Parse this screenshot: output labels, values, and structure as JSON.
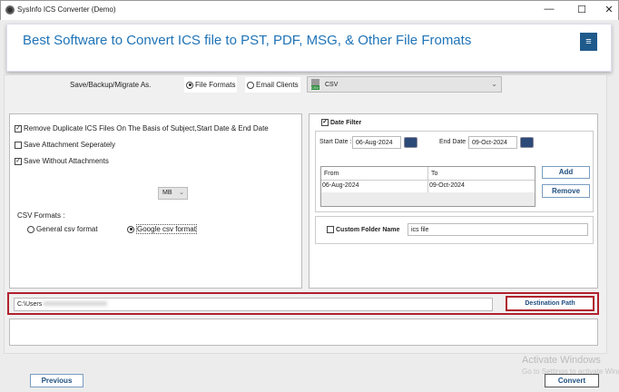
{
  "window": {
    "title": "SysInfo ICS Converter (Demo)",
    "minimize": "—",
    "maximize": "☐",
    "close": "✕"
  },
  "banner": {
    "headline": "Best Software to Convert ICS file to PST, PDF, MSG, & Other File Fromats",
    "menu_icon": "≡"
  },
  "save_as": {
    "label": "Save/Backup/Migrate As.",
    "options": [
      {
        "label": "File Formats",
        "selected": true
      },
      {
        "label": "Email Clients",
        "selected": false
      }
    ],
    "format_selected": "CSV",
    "format_icon_text": "CSV"
  },
  "options": {
    "remove_duplicates": {
      "label": "Remove Duplicate ICS Files On The Basis of Subject,Start Date & End Date",
      "checked": true
    },
    "save_attachment_separately": {
      "label": "Save Attachment Seperately",
      "checked": false
    },
    "save_without_attachments": {
      "label": "Save Without Attachments",
      "checked": true
    },
    "size_unit": "MB",
    "csv_formats_label": "CSV Formats :",
    "csv_formats": [
      {
        "label": "General csv format",
        "selected": false
      },
      {
        "label": "Google csv format",
        "selected": true
      }
    ]
  },
  "date_filter": {
    "label": "Date Filter",
    "checked": true,
    "start_label": "Start Date :",
    "start_value": "06-Aug-2024",
    "end_label": "End Date :",
    "end_value": "09-Oct-2024",
    "table": {
      "headers": [
        "From",
        "To"
      ],
      "rows": [
        [
          "06-Aug-2024",
          "09-Oct-2024"
        ]
      ]
    },
    "add": "Add",
    "remove": "Remove"
  },
  "custom_folder": {
    "label": "Custom Folder Name",
    "checked": false,
    "value": "ics file"
  },
  "destination": {
    "path": "C:\\Users",
    "button": "Destination Path"
  },
  "footer": {
    "previous": "Previous",
    "convert": "Convert"
  },
  "watermark": {
    "line1": "Activate Windows",
    "line2": "Go to Settings to activate Windows."
  }
}
